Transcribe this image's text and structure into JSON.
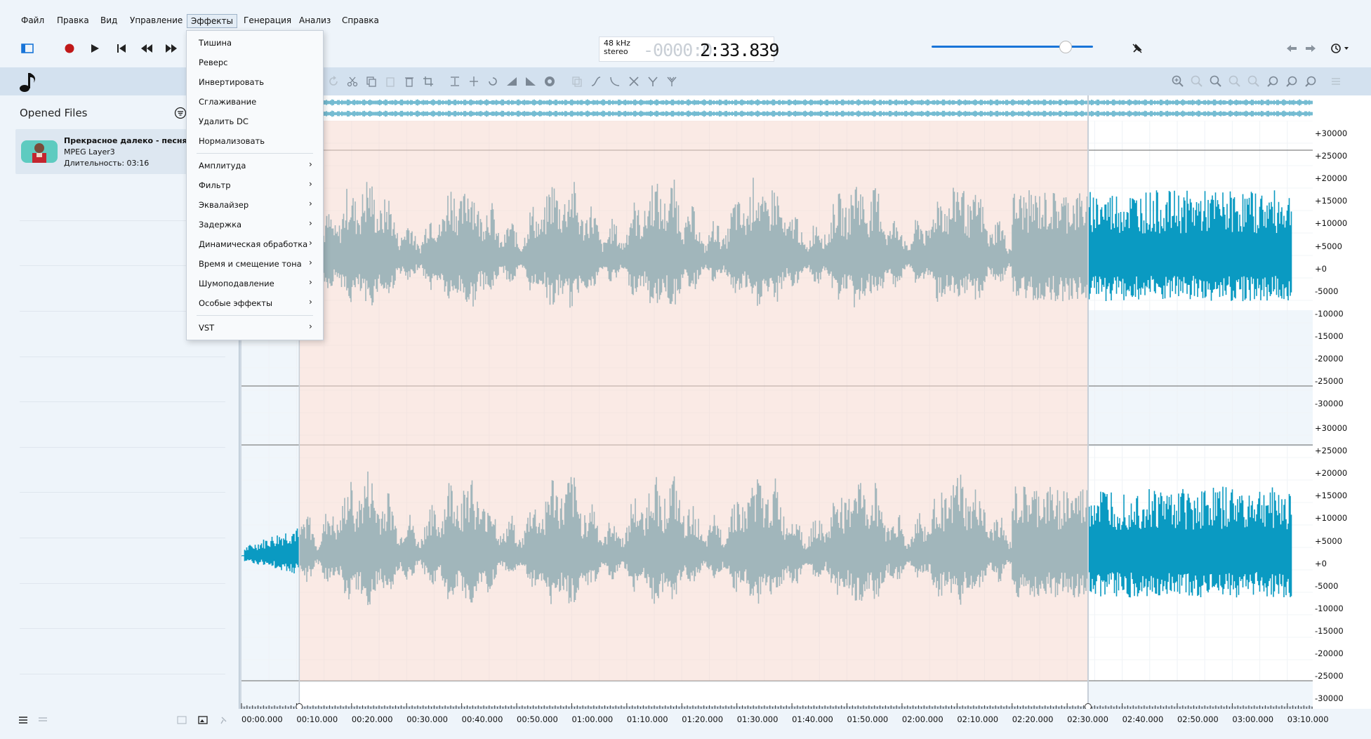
{
  "menu": [
    "Файл",
    "Правка",
    "Вид",
    "Управление",
    "Эффекты",
    "Генерация",
    "Анализ",
    "Справка"
  ],
  "display": {
    "rate_line1": "48 kHz",
    "rate_line2": "stereo",
    "time_faded": "-0000:0",
    "time_main": "2:33.839"
  },
  "volume_level": 0.8,
  "sidebar": {
    "title": "Opened Files",
    "file": {
      "name": "Прекрасное далеко - песня из",
      "format": "MPEG Layer3",
      "duration": "Длительность: 03:16"
    }
  },
  "effects_menu": [
    {
      "label": "Тишина",
      "submenu": false
    },
    {
      "label": "Реверс",
      "submenu": false
    },
    {
      "label": "Инвертировать",
      "submenu": false
    },
    {
      "label": "Сглаживание",
      "submenu": false
    },
    {
      "label": "Удалить DC",
      "submenu": false
    },
    {
      "label": "Нормализовать",
      "submenu": false
    },
    {
      "label": "Амплитуда",
      "submenu": true
    },
    {
      "label": "Фильтр",
      "submenu": true
    },
    {
      "label": "Эквалайзер",
      "submenu": true
    },
    {
      "label": "Задержка",
      "submenu": true
    },
    {
      "label": "Динамическая обработка",
      "submenu": true
    },
    {
      "label": "Время и смещение тона",
      "submenu": true
    },
    {
      "label": "Шумоподавление",
      "submenu": true
    },
    {
      "label": "Особые эффекты",
      "submenu": true
    },
    {
      "label": "VST",
      "submenu": true
    }
  ],
  "y_ruler_top": [
    "+30000",
    "+25000",
    "+20000",
    "+15000",
    "+10000",
    "+5000",
    "+0",
    "-5000",
    "-10000",
    "-15000",
    "-20000",
    "-25000",
    "-30000"
  ],
  "y_ruler_bottom": [
    "+30000",
    "+25000",
    "+20000",
    "+15000",
    "+10000",
    "+5000",
    "+0",
    "-5000",
    "-10000",
    "-15000",
    "-20000",
    "-25000",
    "-30000"
  ],
  "time_ruler": [
    "00:00.000",
    "00:10.000",
    "00:20.000",
    "00:30.000",
    "00:40.000",
    "00:50.000",
    "01:00.000",
    "01:10.000",
    "01:20.000",
    "01:30.000",
    "01:40.000",
    "01:50.000",
    "02:00.000",
    "02:10.000",
    "02:20.000",
    "02:30.000",
    "02:40.000",
    "02:50.000",
    "03:00.000",
    "03:10.000"
  ],
  "selection": {
    "start_seconds": 10.5,
    "end_seconds": 153.8
  },
  "colors": {
    "waveform": "#0a9ac2",
    "waveform_selected": "#3b8ca3",
    "selection": "#f6d9d0",
    "accent": "#1874d8",
    "record": "#c01818"
  },
  "icons": [
    "toggle-sidebar-icon",
    "record-icon",
    "play-icon",
    "skip-start-icon",
    "rewind-icon",
    "fast-forward-icon",
    "pin-icon",
    "arrow-left-icon",
    "arrow-right-icon",
    "history-icon",
    "music-note-icon",
    "filter-icon"
  ]
}
